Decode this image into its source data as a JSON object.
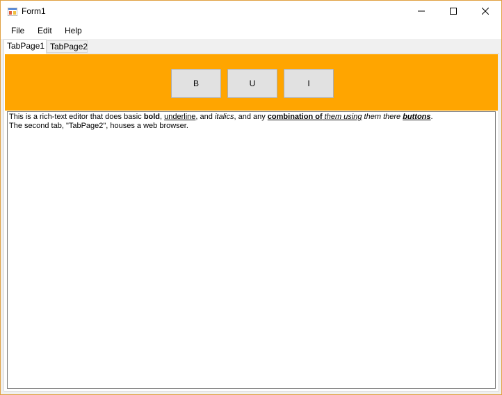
{
  "window": {
    "title": "Form1",
    "controls": {
      "minimize": "minimize-icon",
      "maximize": "maximize-icon",
      "close": "close-icon"
    }
  },
  "menu": {
    "items": [
      {
        "label": "File"
      },
      {
        "label": "Edit"
      },
      {
        "label": "Help"
      }
    ]
  },
  "tabs": [
    {
      "label": "TabPage1",
      "active": true
    },
    {
      "label": "TabPage2",
      "active": false
    }
  ],
  "toolbar": {
    "background": "#ffa500",
    "buttons": [
      {
        "label": "B"
      },
      {
        "label": "U"
      },
      {
        "label": "I"
      }
    ]
  },
  "editor": {
    "line1": {
      "t1": "This is a rich-text editor that does basic ",
      "t2": "bold",
      "t3": ", ",
      "t4": "underline",
      "t5": ", and ",
      "t6": "italics",
      "t7": ", and any ",
      "t8": "combination of",
      "t9": " them using",
      "t10": " them there ",
      "t11": "buttons",
      "t12": "."
    },
    "line2": "The second tab, \"TabPage2\", houses a web browser."
  }
}
